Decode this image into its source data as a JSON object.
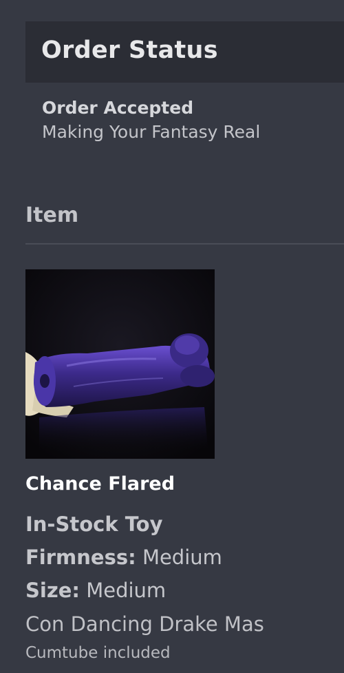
{
  "order_status": {
    "title": "Order Status",
    "status": "Order Accepted",
    "message": "Making Your Fantasy Real"
  },
  "item": {
    "heading": "Item",
    "image_alt": "Chance Flared product photo",
    "name": "Chance Flared",
    "type": "In-Stock Toy",
    "firmness_label": "Firmness:",
    "firmness_value": "Medium",
    "size_label": "Size:",
    "size_value": "Medium",
    "color": "Con Dancing Drake Mas",
    "extra": "Cumtube included"
  }
}
